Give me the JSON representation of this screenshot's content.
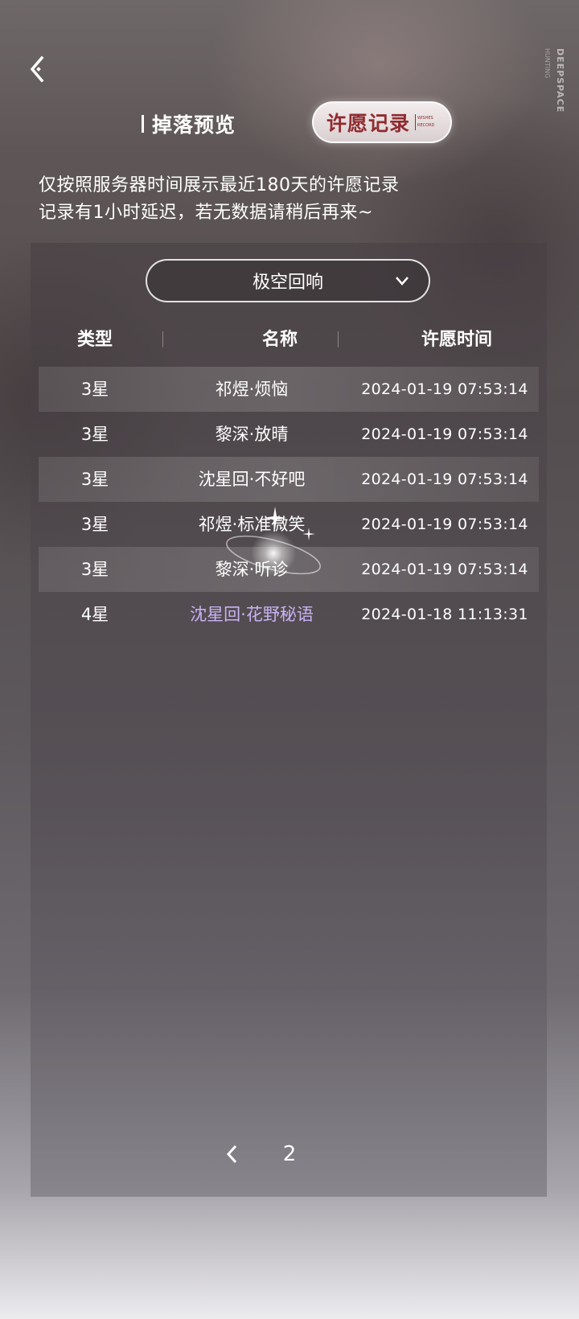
{
  "brand": {
    "vertical": "DEEPSPACE",
    "sub": "HUNTING"
  },
  "tabs": [
    {
      "label": "掉落预览",
      "active": false
    },
    {
      "label": "许愿记录",
      "active": true,
      "badge_line1": "WISHES",
      "badge_line2": "RECORD"
    }
  ],
  "notice": {
    "line1": "仅按照服务器时间展示最近180天的许愿记录",
    "line2": "记录有1小时延迟，若无数据请稍后再来~"
  },
  "pool_select": {
    "value": "极空回响"
  },
  "table": {
    "headers": [
      "类型",
      "名称",
      "许愿时间"
    ],
    "rows": [
      {
        "type": "3星",
        "name": "祁煜·烦恼",
        "time": "2024-01-19 07:53:14"
      },
      {
        "type": "3星",
        "name": "黎深·放晴",
        "time": "2024-01-19 07:53:14"
      },
      {
        "type": "3星",
        "name": "沈星回·不好吧",
        "time": "2024-01-19 07:53:14"
      },
      {
        "type": "3星",
        "name": "祁煜·标准微笑",
        "time": "2024-01-19 07:53:14"
      },
      {
        "type": "3星",
        "name": "黎深·听诊",
        "time": "2024-01-19 07:53:14"
      },
      {
        "type": "4星",
        "name": "沈星回·花野秘语",
        "time": "2024-01-18 11:13:31"
      }
    ]
  },
  "pager": {
    "current_page": "2"
  },
  "colors": {
    "four_star": "#c8b2f3",
    "active_tab_text": "#8f2b2f"
  }
}
